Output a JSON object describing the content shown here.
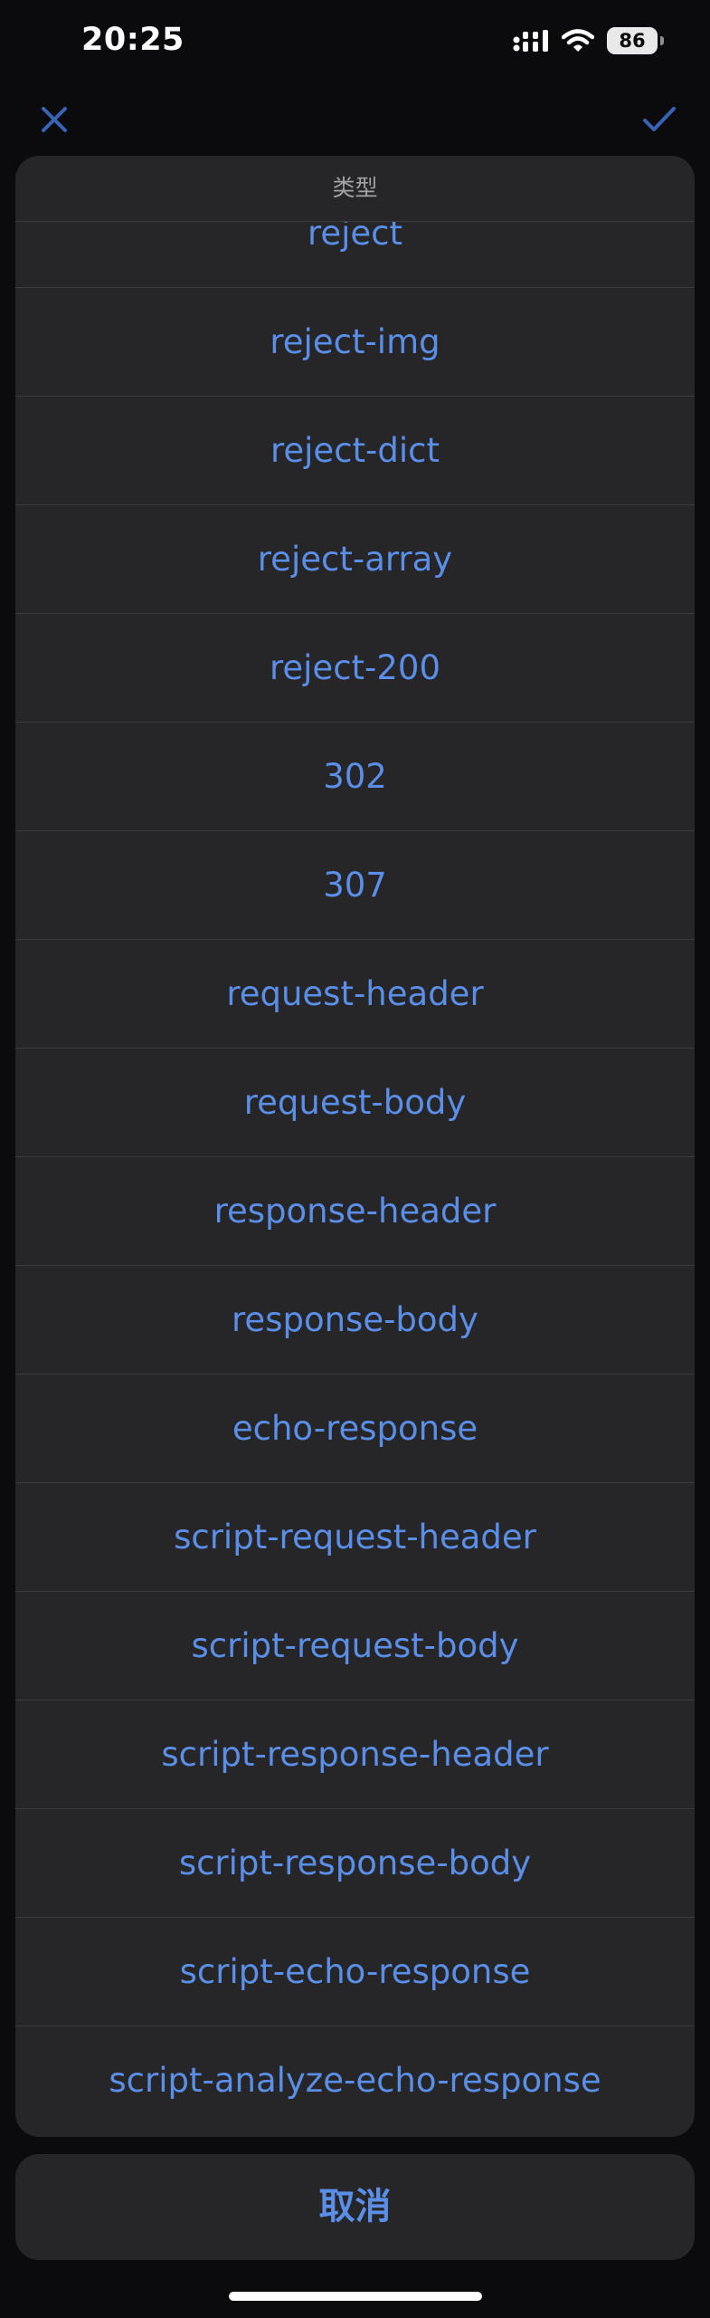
{
  "status_bar": {
    "time": "20:25",
    "battery_level": "86",
    "icons": [
      "signal-icon",
      "wifi-icon",
      "battery-icon"
    ]
  },
  "nav": {
    "close_icon": "close-icon",
    "confirm_icon": "checkmark-icon"
  },
  "colors": {
    "accent": "#5b8ee6",
    "sheet_background": "#262628",
    "page_background": "#0b0b0d",
    "separator": "#3c3c3f",
    "title_text": "#a1a1a6"
  },
  "picker": {
    "title": "类型",
    "options": [
      "reject",
      "reject-img",
      "reject-dict",
      "reject-array",
      "reject-200",
      "302",
      "307",
      "request-header",
      "request-body",
      "response-header",
      "response-body",
      "echo-response",
      "script-request-header",
      "script-request-body",
      "script-response-header",
      "script-response-body",
      "script-echo-response",
      "script-analyze-echo-response"
    ]
  },
  "cancel_label": "取消"
}
